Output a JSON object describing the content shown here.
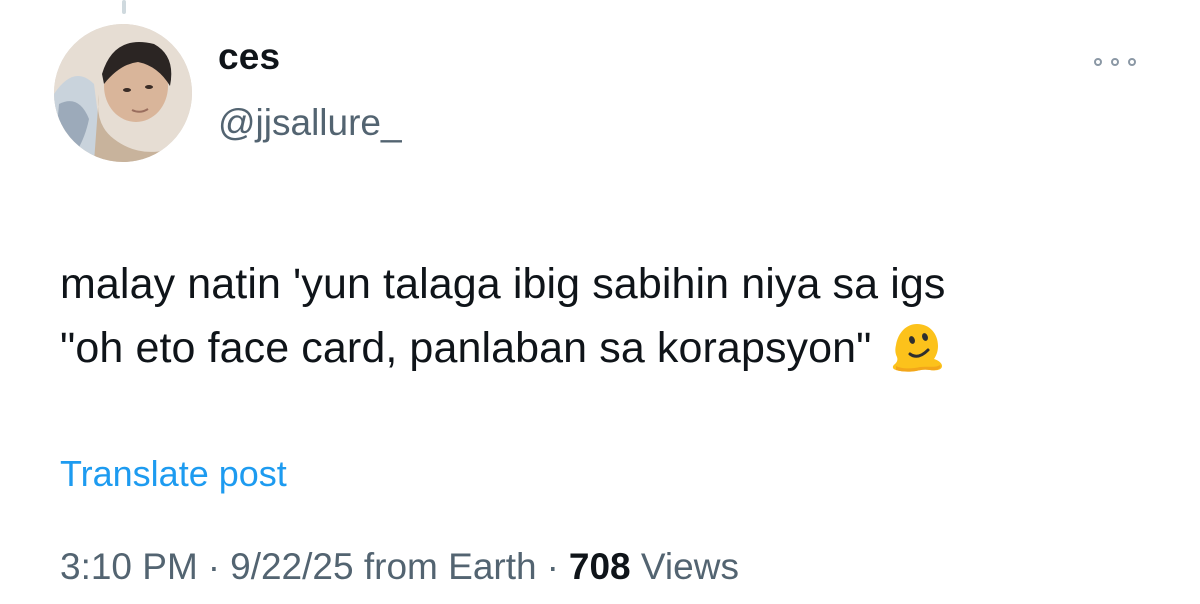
{
  "author": {
    "display_name": "ces",
    "handle": "@jjsallure_"
  },
  "post": {
    "line1": "malay natin 'yun talaga ibig sabihin niya sa igs",
    "line2": "\"oh eto face card, panlaban sa korapsyon\"",
    "emoji": "melting-face-icon"
  },
  "translate_label": "Translate post",
  "meta": {
    "time": "3:10 PM",
    "separator": "·",
    "date": "9/22/25",
    "location": "from Earth",
    "views_count": "708",
    "views_label": "Views"
  },
  "colors": {
    "text": "#0f1419",
    "secondary": "#536471",
    "link": "#1d9bf0"
  }
}
